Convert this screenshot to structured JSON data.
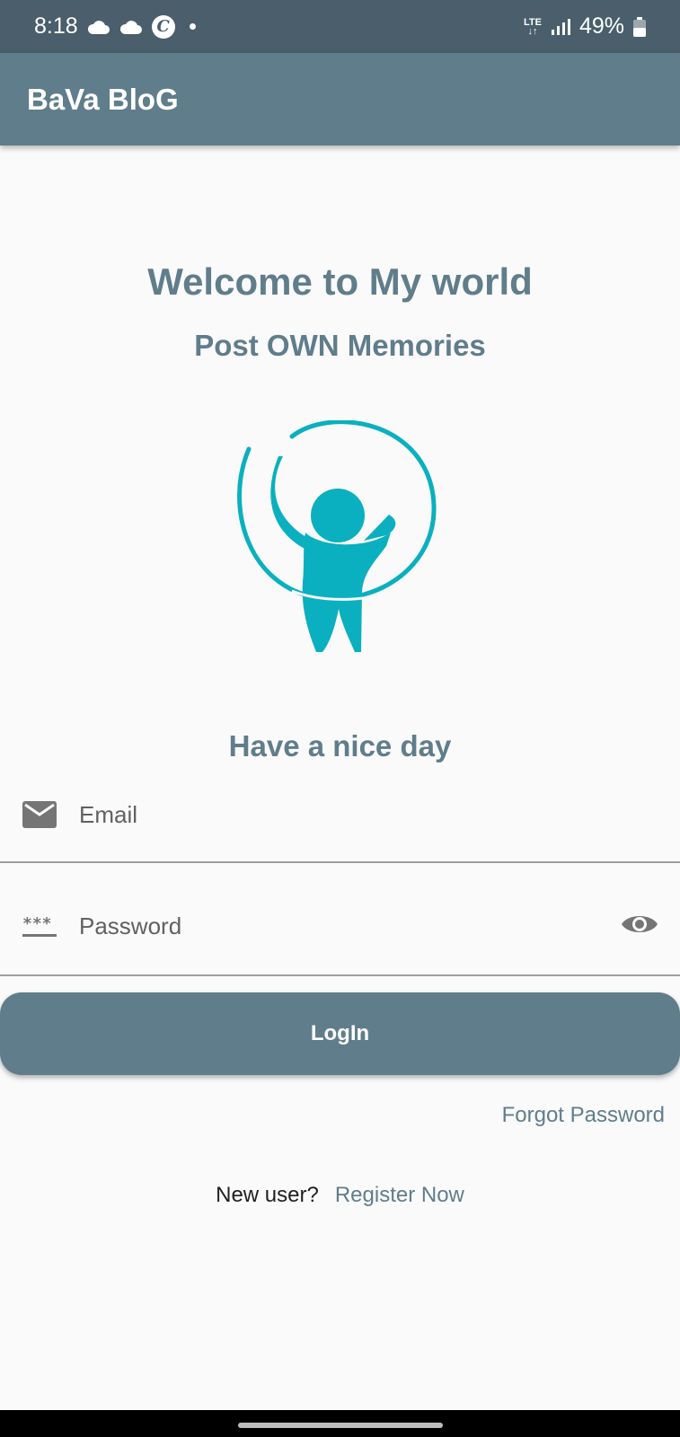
{
  "status_bar": {
    "time": "8:18",
    "network": "LTE",
    "battery": "49%",
    "icons": [
      "cloud-icon",
      "cloud-icon",
      "c-app-icon",
      "dot-icon",
      "lte-icon",
      "signal-icon",
      "battery-icon"
    ]
  },
  "app_bar": {
    "title": "BaVa BloG"
  },
  "welcome": {
    "title": "Welcome to My world",
    "subtitle": "Post OWN Memories",
    "logo_color": "#0ab0bf"
  },
  "greeting": "Have a nice day",
  "form": {
    "email_placeholder": "Email",
    "password_placeholder": "Password",
    "password_mask_icon": "***"
  },
  "login_button": "LogIn",
  "forgot_password": "Forgot Password",
  "register": {
    "prompt": "New user?",
    "link": "Register Now"
  },
  "colors": {
    "primary": "#607d8b",
    "status_bar": "#4a5f6b",
    "background": "#fafafa",
    "logo": "#0ab0bf"
  }
}
